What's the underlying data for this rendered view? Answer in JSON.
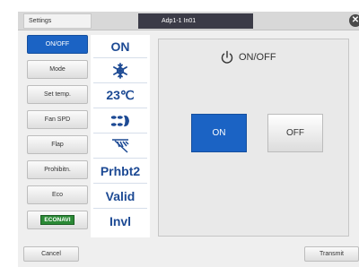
{
  "header": {
    "settings_label": "Settings",
    "unit_label": "Adp1-1 In01",
    "close_icon": "close-icon"
  },
  "menu": {
    "items": [
      {
        "label": "ON/OFF",
        "active": true
      },
      {
        "label": "Mode"
      },
      {
        "label": "Set temp."
      },
      {
        "label": "Fan SPD"
      },
      {
        "label": "Flap"
      },
      {
        "label": "Prohibitn."
      },
      {
        "label": "Eco"
      },
      {
        "label": "ECONAVI"
      }
    ]
  },
  "values": {
    "onoff": "ON",
    "mode_icon": "snowflake-icon",
    "settemp": "23℃",
    "fan_icon": "fan-speed-icon",
    "flap_icon": "flap-icon",
    "prohibit": "Prhbt2",
    "eco": "Valid",
    "econavi": "Invl"
  },
  "panel": {
    "title": "ON/OFF",
    "title_icon": "power-icon",
    "on_label": "ON",
    "off_label": "OFF",
    "selected": "ON"
  },
  "footer": {
    "cancel_label": "Cancel",
    "transmit_label": "Transmit"
  },
  "colors": {
    "accent": "#1b63c4",
    "value_text": "#1d4a94",
    "econavi_green": "#2b8a36",
    "header_dark": "#3b3b47"
  }
}
